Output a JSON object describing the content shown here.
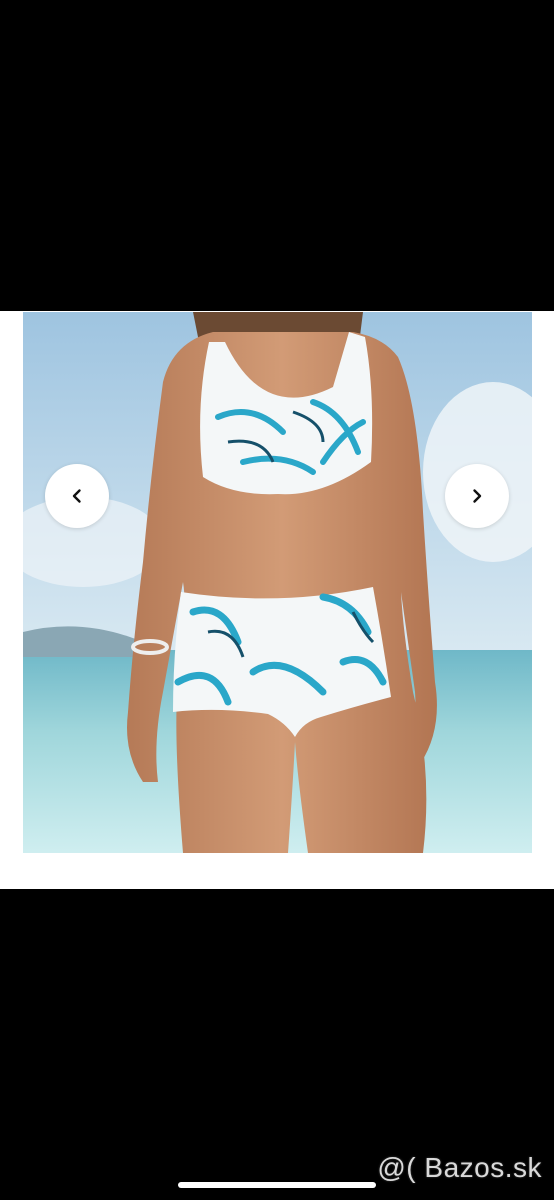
{
  "gallery": {
    "photo_alt": "",
    "prev_icon": "chevron-left-icon",
    "next_icon": "chevron-right-icon",
    "colors": {
      "sky": "#a9cbe3",
      "sea": "#8fd0d6",
      "swimsuit": "#f4f7f8",
      "print_blue": "#2aa7c9",
      "skin": "#c98f6a"
    }
  },
  "watermark": {
    "text": "@( Bazos.sk"
  }
}
